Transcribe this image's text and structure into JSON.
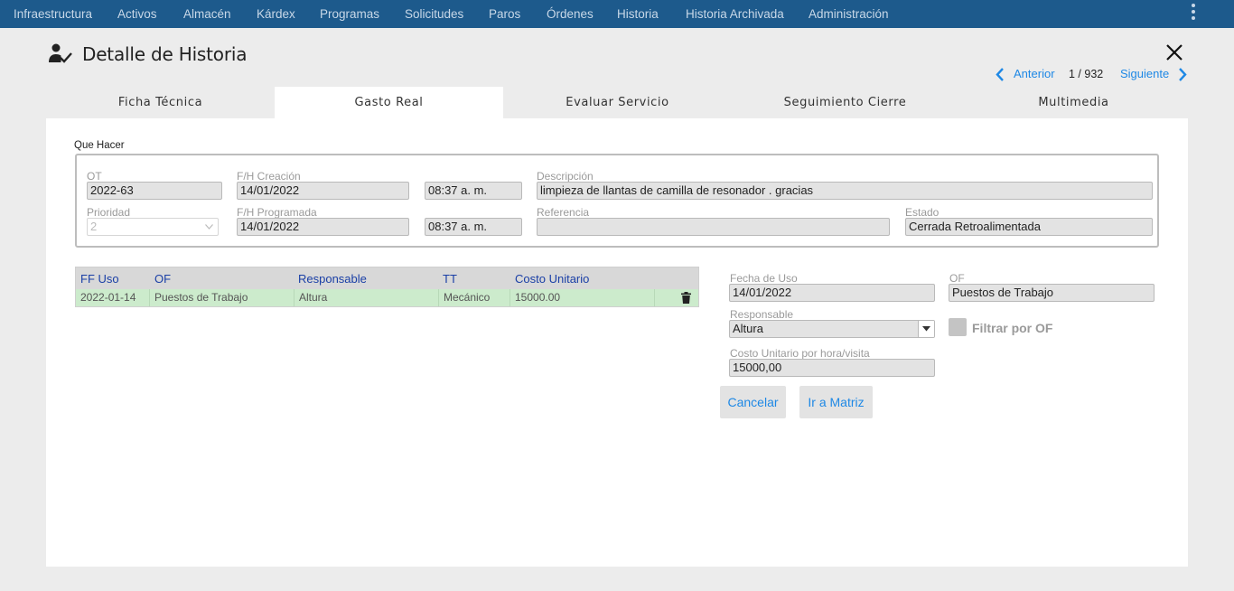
{
  "nav": {
    "items": [
      "Infraestructura",
      "Activos",
      "Almacén",
      "Kárdex",
      "Programas",
      "Solicitudes",
      "Paros",
      "Órdenes",
      "Historia",
      "Historia Archivada",
      "Administración"
    ]
  },
  "header": {
    "title": "Detalle de Historia",
    "pager": {
      "prev_label": "Anterior",
      "count": "1 / 932",
      "next_label": "Siguiente"
    }
  },
  "tabs": [
    {
      "label": "Ficha Técnica",
      "active": false
    },
    {
      "label": "Gasto Real",
      "active": true
    },
    {
      "label": "Evaluar Servicio",
      "active": false
    },
    {
      "label": "Seguimiento Cierre",
      "active": false
    },
    {
      "label": "Multimedia",
      "active": false
    }
  ],
  "que_hacer": {
    "section_label": "Que Hacer",
    "ot": {
      "label": "OT",
      "value": "2022-63"
    },
    "fh_creacion": {
      "label": "F/H Creación",
      "date": "14/01/2022",
      "time": "08:37 a. m."
    },
    "descripcion": {
      "label": "Descripción",
      "value": "limpieza de llantas de camilla de resonador . gracias"
    },
    "prioridad": {
      "label": "Prioridad",
      "value": "2"
    },
    "fh_programada": {
      "label": "F/H Programada",
      "date": "14/01/2022",
      "time": "08:37 a. m."
    },
    "referencia": {
      "label": "Referencia",
      "value": ""
    },
    "estado": {
      "label": "Estado",
      "value": "Cerrada Retroalimentada"
    }
  },
  "grid": {
    "columns": [
      "FF Uso",
      "OF",
      "Responsable",
      "TT",
      "Costo Unitario"
    ],
    "rows": [
      {
        "ff_uso": "2022-01-14",
        "of": "Puestos de Trabajo",
        "responsable": "Altura",
        "tt": "Mecánico",
        "costo": "15000.00"
      }
    ]
  },
  "detail": {
    "fecha_uso": {
      "label": "Fecha de Uso",
      "value": "14/01/2022"
    },
    "of": {
      "label": "OF",
      "value": "Puestos de Trabajo"
    },
    "responsable": {
      "label": "Responsable",
      "value": "Altura"
    },
    "filtrar_label": "Filtrar por OF",
    "costo": {
      "label": "Costo Unitario por hora/visita",
      "value": "15000,00"
    },
    "cancel_label": "Cancelar",
    "matriz_label": "Ir a Matriz"
  },
  "colors": {
    "nav_bg": "#1d5a8c",
    "link": "#1e88e5",
    "grid_header_text": "#1a3fa6",
    "row_selected": "#ccebcc"
  }
}
